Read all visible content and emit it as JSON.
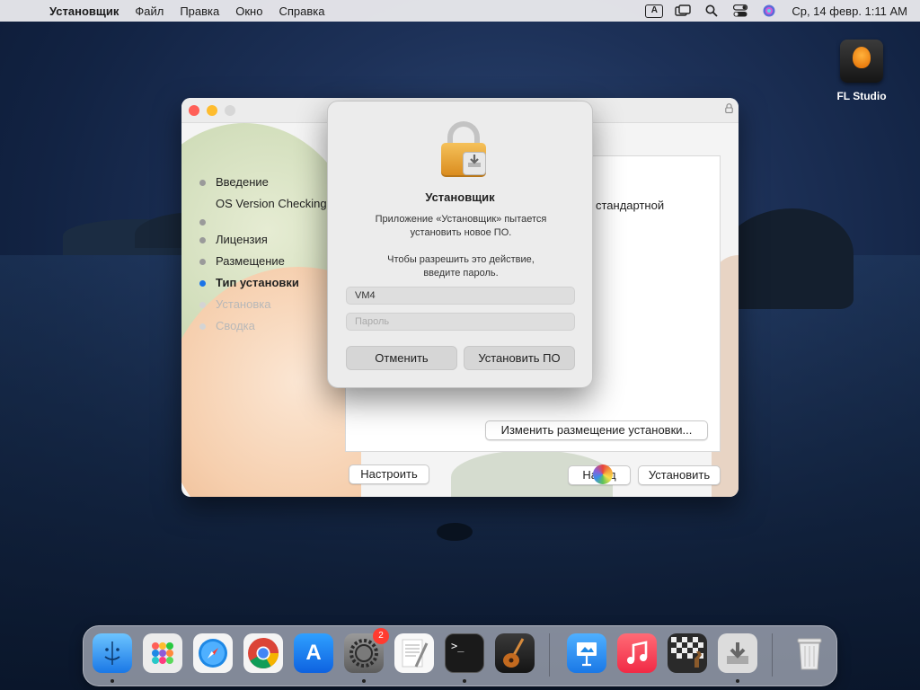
{
  "menubar": {
    "apple_glyph": "",
    "app_name": "Установщик",
    "items": [
      "Файл",
      "Правка",
      "Окно",
      "Справка"
    ],
    "input_source": "A",
    "clock": "Ср, 14 февр.  1:11 AM"
  },
  "desktop": {
    "icon_label": "FL Studio"
  },
  "installer": {
    "steps": [
      {
        "label": "Введение"
      },
      {
        "label": "OS Version Checking"
      },
      {
        "label": "Лицензия"
      },
      {
        "label": "Размещение"
      },
      {
        "label": "Тип установки"
      },
      {
        "label": "Установка"
      },
      {
        "label": "Сводка"
      }
    ],
    "content_text": "стандартной",
    "change_location_label": "Изменить размещение установки...",
    "customize_label": "Настроить",
    "back_label": "Назад",
    "install_label": "Установить"
  },
  "auth_dialog": {
    "title": "Установщик",
    "message1_line1": "Приложение «Установщик» пытается",
    "message1_line2": "установить новое ПО.",
    "message2_line1": "Чтобы разрешить это действие,",
    "message2_line2": "введите пароль.",
    "username_value": "VM4",
    "password_placeholder": "Пароль",
    "cancel_label": "Отменить",
    "confirm_label": "Установить ПО"
  },
  "dock": {
    "settings_badge": "2",
    "terminal_prompt": ">_",
    "app_store_glyph": "A",
    "colors": {
      "finder": "#2a8ef0",
      "safari": "#1e88e5",
      "app_store": "#1c7cf0",
      "music": "#fa3c4c",
      "keynote": "#2b9af3"
    }
  }
}
